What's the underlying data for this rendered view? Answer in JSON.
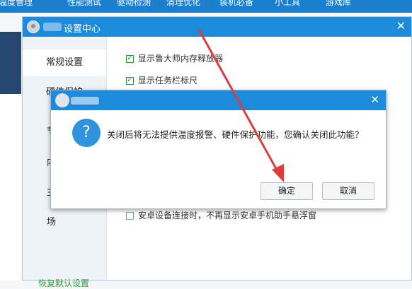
{
  "topnav": {
    "items": [
      "温度管理",
      "性能测试",
      "驱动检测",
      "清理优化",
      "装机必备",
      "小工具",
      "游戏库"
    ]
  },
  "settings_window": {
    "title": "设置中心",
    "close_glyph": "✕",
    "sidebar": {
      "items": [
        "常规设置",
        "硬件保护",
        "节",
        "内",
        "主",
        "场"
      ],
      "restore_label": "恢复默认设置"
    },
    "options": [
      {
        "label": "显示鲁大师内存释放器",
        "checked": true
      },
      {
        "label": "显示任务栏标尺",
        "checked": true
      },
      {
        "label": "安卓设备连接时，不再显示安卓手机助手悬浮窗",
        "checked": false
      }
    ]
  },
  "dialog": {
    "close_glyph": "✕",
    "icon_glyph": "?",
    "message": "关闭后将无法提供温度报警、硬件保护功能，您确认关闭此功能？",
    "ok_label": "确定",
    "cancel_label": "取消"
  },
  "colors": {
    "title_bar": "#1c8bdc",
    "accent_green": "#2f9b3b",
    "arrow_red": "#e03b3b"
  }
}
